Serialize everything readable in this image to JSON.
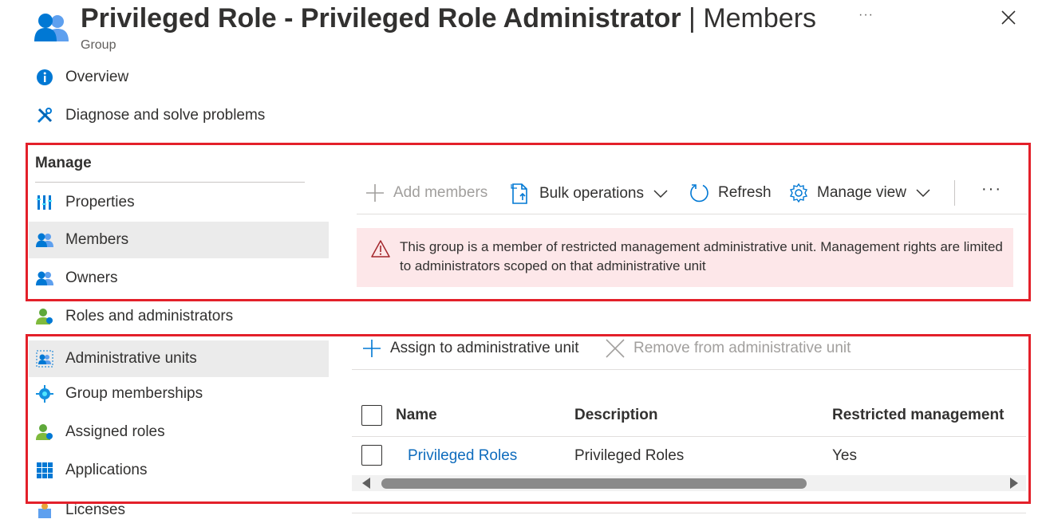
{
  "header": {
    "title_main": "Privileged Role - Privileged Role Administrator",
    "title_sep": " | ",
    "title_sub": "Members",
    "type_label": "Group",
    "more": "···"
  },
  "sidebar": {
    "section_label": "Manage",
    "items": [
      {
        "label": "Overview",
        "icon": "info-icon"
      },
      {
        "label": "Diagnose and solve problems",
        "icon": "wrench-icon"
      },
      {
        "label": "Properties",
        "icon": "properties-icon"
      },
      {
        "label": "Members",
        "icon": "members-icon",
        "active": true
      },
      {
        "label": "Owners",
        "icon": "owners-icon"
      },
      {
        "label": "Roles and administrators",
        "icon": "roles-icon"
      },
      {
        "label": "Administrative units",
        "icon": "admin-units-icon",
        "active": true
      },
      {
        "label": "Group memberships",
        "icon": "group-memberships-icon"
      },
      {
        "label": "Assigned roles",
        "icon": "assigned-roles-icon"
      },
      {
        "label": "Applications",
        "icon": "applications-icon"
      },
      {
        "label": "Licenses",
        "icon": "licenses-icon"
      }
    ]
  },
  "members_toolbar": {
    "add_members": "Add members",
    "bulk_operations": "Bulk operations",
    "refresh": "Refresh",
    "manage_view": "Manage view",
    "more": "···"
  },
  "warning": {
    "text": "This group is a member of restricted management administrative unit. Management rights are limited to administrators scoped on that administrative unit"
  },
  "admin_units_toolbar": {
    "assign": "Assign to administrative unit",
    "remove": "Remove from administrative unit"
  },
  "table": {
    "columns": [
      "Name",
      "Description",
      "Restricted management"
    ],
    "rows": [
      {
        "name": "Privileged Roles",
        "description": "Privileged Roles",
        "restricted": "Yes"
      }
    ]
  },
  "colors": {
    "accent": "#0f6cbd",
    "highlight_border": "#e3202a",
    "warning_bg": "#fde7e9",
    "warning_icon": "#a4262c"
  }
}
